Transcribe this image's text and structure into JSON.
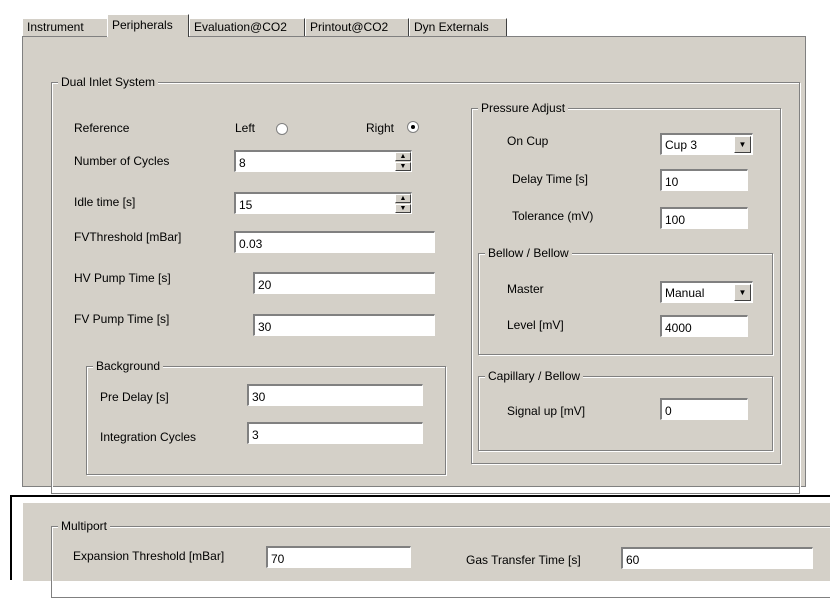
{
  "tabs": [
    "Instrument",
    "Peripherals",
    "Evaluation@CO2",
    "Printout@CO2",
    "Dyn Externals"
  ],
  "dual_inlet": {
    "title": "Dual Inlet System",
    "reference_label": "Reference",
    "left_label": "Left",
    "right_label": "Right",
    "selected": "Right",
    "cycles_label": "Number of Cycles",
    "cycles_value": "8",
    "idle_label": "Idle time [s]",
    "idle_value": "15",
    "fv_threshold_label": "FVThreshold [mBar]",
    "fv_threshold_value": "0.03",
    "hv_pump_label": "HV Pump Time [s]",
    "hv_pump_value": "20",
    "fv_pump_label": "FV Pump Time [s]",
    "fv_pump_value": "30"
  },
  "background": {
    "title": "Background",
    "pre_delay_label": "Pre Delay [s]",
    "pre_delay_value": "30",
    "integration_label": "Integration Cycles",
    "integration_value": "3"
  },
  "pressure_adjust": {
    "title": "Pressure Adjust",
    "on_cup_label": "On Cup",
    "on_cup_value": "Cup 3",
    "delay_label": "Delay Time [s]",
    "delay_value": "10",
    "tolerance_label": "Tolerance (mV)",
    "tolerance_value": "100"
  },
  "bellow": {
    "title": "Bellow / Bellow",
    "master_label": "Master",
    "master_value": "Manual",
    "level_label": "Level [mV]",
    "level_value": "4000"
  },
  "capillary": {
    "title": "Capillary / Bellow",
    "signal_label": "Signal up [mV]",
    "signal_value": "0"
  },
  "multiport": {
    "title": "Multiport",
    "expansion_label": "Expansion Threshold [mBar]",
    "expansion_value": "70",
    "gas_label": "Gas Transfer Time [s]",
    "gas_value": "60"
  },
  "icons": {
    "spin_up": "▲",
    "spin_down": "▼",
    "dropdown": "▼"
  },
  "colors": {
    "face": "#d4d0c8",
    "shadow": "#808080",
    "field": "#ffffff"
  }
}
